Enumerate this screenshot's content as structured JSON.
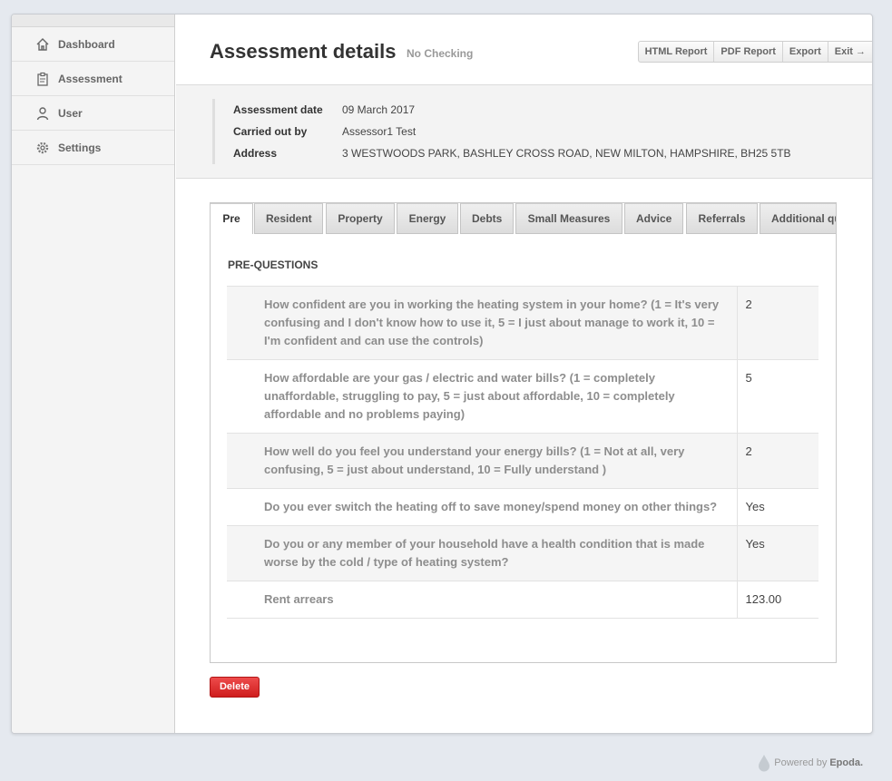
{
  "sidebar": {
    "items": [
      {
        "label": "Dashboard",
        "icon": "house-icon"
      },
      {
        "label": "Assessment",
        "icon": "clipboard-icon"
      },
      {
        "label": "User",
        "icon": "user-icon"
      },
      {
        "label": "Settings",
        "icon": "gear-icon"
      }
    ]
  },
  "header": {
    "title": "Assessment details",
    "subtitle": "No Checking",
    "buttons": [
      "HTML Report",
      "PDF Report",
      "Export",
      "Exit →"
    ]
  },
  "info": {
    "rows": [
      {
        "label": "Assessment date",
        "value": "09 March 2017"
      },
      {
        "label": "Carried out by",
        "value": "Assessor1 Test"
      },
      {
        "label": "Address",
        "value": "3 WESTWOODS PARK, BASHLEY CROSS ROAD, NEW MILTON, HAMPSHIRE, BH25 5TB"
      }
    ]
  },
  "tabs": [
    {
      "label": "Pre",
      "active": true
    },
    {
      "label": "Resident"
    },
    {
      "label": "Property"
    },
    {
      "label": "Energy"
    },
    {
      "label": "Debts"
    },
    {
      "label": "Small Measures"
    },
    {
      "label": "Advice"
    },
    {
      "label": "Referrals"
    },
    {
      "label": "Additional qu"
    }
  ],
  "section": {
    "title": "PRE-QUESTIONS",
    "rows": [
      {
        "question": "How confident are you in working the heating system in your home? (1 = It's very confusing and I don't know how to use it, 5 = I just about manage to work it, 10 = I'm confident and can use the controls)",
        "answer": "2"
      },
      {
        "question": "How affordable are your gas / electric and water bills? (1 = completely unaffordable, struggling to pay, 5 = just about affordable, 10 = completely affordable and no problems paying)",
        "answer": "5"
      },
      {
        "question": "How well do you feel you understand your energy bills? (1 = Not at all, very confusing, 5 = just about understand, 10 = Fully understand )",
        "answer": "2"
      },
      {
        "question": "Do you ever switch the heating off to save money/spend money on other things?",
        "answer": "Yes"
      },
      {
        "question": "Do you or any member of your household have a health condition that is made worse by the cold / type of heating system?",
        "answer": "Yes"
      },
      {
        "question": "Rent arrears",
        "answer": "123.00"
      }
    ]
  },
  "delete_label": "Delete",
  "footer": {
    "prefix": "Powered by",
    "brand": "Epoda."
  }
}
